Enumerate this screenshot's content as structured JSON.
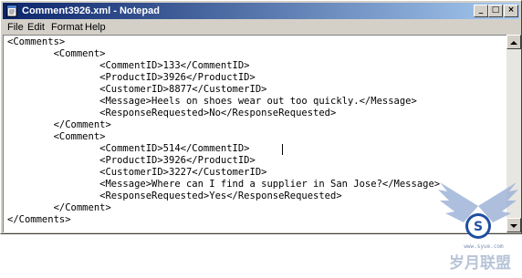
{
  "window": {
    "title": "Comment3926.xml - Notepad",
    "controls": {
      "minimize": "_",
      "maximize": "□",
      "close": "×"
    }
  },
  "menu": {
    "items": [
      {
        "label": "File"
      },
      {
        "label": "Edit"
      },
      {
        "label": "Format"
      },
      {
        "label": "Help"
      }
    ]
  },
  "editor": {
    "lines": [
      "<Comments>",
      "        <Comment>",
      "                <CommentID>133</CommentID>",
      "                <ProductID>3926</ProductID>",
      "                <CustomerID>8877</CustomerID>",
      "                <Message>Heels on shoes wear out too quickly.</Message>",
      "                <ResponseRequested>No</ResponseRequested>",
      "        </Comment>",
      "        <Comment>",
      "                <CommentID>514</CommentID>",
      "                <ProductID>3926</ProductID>",
      "                <CustomerID>3227</CustomerID>",
      "                <Message>Where can I find a supplier in San Jose?</Message>",
      "                <ResponseRequested>Yes</ResponseRequested>",
      "        </Comment>",
      "</Comments>"
    ]
  },
  "watermark": {
    "logo_text": "岁月联盟",
    "url_text": "www.syue.com"
  }
}
